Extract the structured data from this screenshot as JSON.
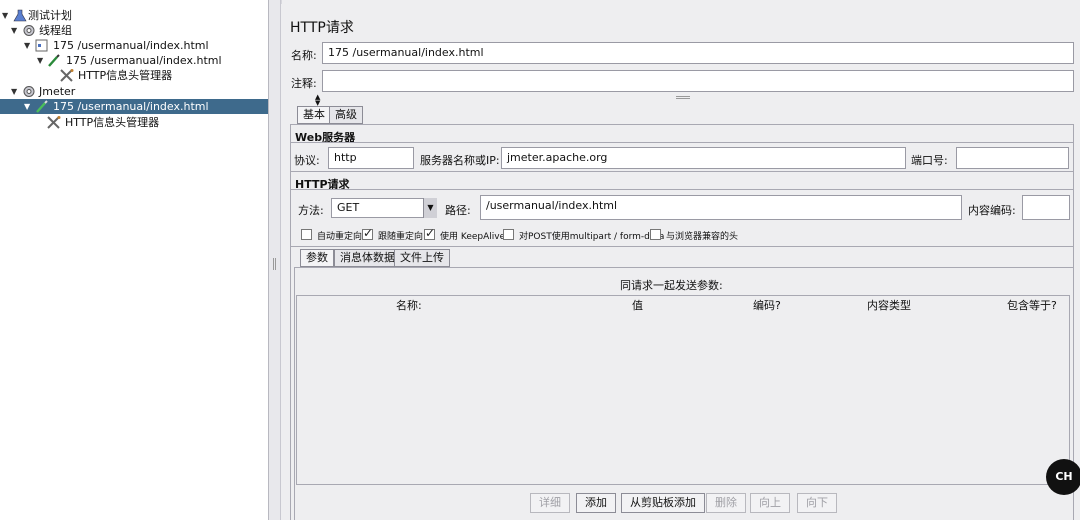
{
  "tree": {
    "items": [
      {
        "label": "测试计划",
        "icon": "flask-icon",
        "expanded": true,
        "selected": false
      },
      {
        "label": "线程组",
        "icon": "gear-icon",
        "expanded": true,
        "selected": false
      },
      {
        "label": "175 /usermanual/index.html",
        "icon": "controller-icon",
        "expanded": true,
        "selected": false
      },
      {
        "label": "175 /usermanual/index.html",
        "icon": "pipette-icon",
        "expanded": true,
        "selected": false
      },
      {
        "label": "HTTP信息头管理器",
        "icon": "tools-icon",
        "expanded": false,
        "selected": false
      },
      {
        "label": "Jmeter",
        "icon": "gear-icon",
        "expanded": true,
        "selected": false
      },
      {
        "label": "175 /usermanual/index.html",
        "icon": "pipette-icon",
        "expanded": true,
        "selected": true
      },
      {
        "label": "HTTP信息头管理器",
        "icon": "tools-icon",
        "expanded": false,
        "selected": false
      }
    ]
  },
  "panel": {
    "title": "HTTP请求",
    "name_label": "名称:",
    "name_value": "175 /usermanual/index.html",
    "comment_label": "注释:",
    "comment_value": ""
  },
  "tabs": [
    {
      "label": "基本",
      "active": true
    },
    {
      "label": "高级",
      "active": false
    }
  ],
  "web_server": {
    "section_title": "Web服务器",
    "protocol_label": "协议:",
    "protocol_value": "http",
    "server_label": "服务器名称或IP:",
    "server_value": "jmeter.apache.org",
    "port_label": "端口号:",
    "port_value": ""
  },
  "http_request": {
    "section_title": "HTTP请求",
    "method_label": "方法:",
    "method_value": "GET",
    "path_label": "路径:",
    "path_value": "/usermanual/index.html",
    "encoding_label": "内容编码:",
    "encoding_value": ""
  },
  "options": [
    {
      "label": "自动重定向",
      "checked": false
    },
    {
      "label": "跟随重定向",
      "checked": true
    },
    {
      "label": "使用 KeepAlive",
      "checked": true
    },
    {
      "label": "对POST使用multipart / form-data",
      "checked": false
    },
    {
      "label": "与浏览器兼容的头",
      "checked": false
    }
  ],
  "sub_tabs": [
    {
      "label": "参数",
      "active": true
    },
    {
      "label": "消息体数据",
      "active": false
    },
    {
      "label": "文件上传",
      "active": false
    }
  ],
  "params": {
    "caption": "同请求一起发送参数:",
    "columns": [
      "名称:",
      "值",
      "编码?",
      "内容类型",
      "包含等于?"
    ]
  },
  "buttons": [
    {
      "label": "详细",
      "enabled": false
    },
    {
      "label": "添加",
      "enabled": true
    },
    {
      "label": "从剪贴板添加",
      "enabled": true
    },
    {
      "label": "删除",
      "enabled": false
    },
    {
      "label": "向上",
      "enabled": false
    },
    {
      "label": "向下",
      "enabled": false
    }
  ],
  "ime_badge": "CH"
}
